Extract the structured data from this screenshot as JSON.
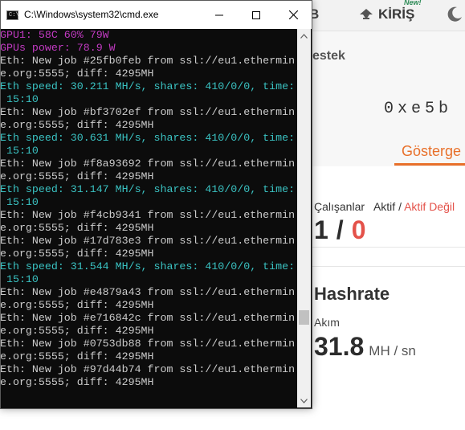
{
  "browser": {
    "nav_partial": "B",
    "login_label": "KİRİŞ",
    "new_badge": "New!",
    "request_partial": "estek",
    "wallet_partial": "0xe5b",
    "tab_dashboard_partial": "Gösterge",
    "workers": {
      "label": "Çalışanlar",
      "active_label": "Aktif",
      "separator": "/",
      "inactive_label": "Aktif Değil",
      "active_count": "1",
      "slash": "/",
      "inactive_count": "0"
    },
    "hashrate": {
      "title": "Hashrate",
      "current_label": "Akım",
      "current_value": "31.8",
      "unit": "MH / sn"
    },
    "colors": {
      "accent": "#e8702a",
      "inactive": "#e4524a"
    }
  },
  "cmd": {
    "title": "C:\\Windows\\system32\\cmd.exe",
    "icon_label": "C:\\",
    "lines": [
      {
        "text": "GPU1: 58C 60% 79W",
        "color": "magenta"
      },
      {
        "text": "GPUs power: 78.9 W",
        "color": "magenta"
      },
      {
        "text": "Eth: New job #25fb0feb from ssl://eu1.ethermin",
        "color": "gray"
      },
      {
        "text": "e.org:5555; diff: 4295MH",
        "color": "gray"
      },
      {
        "text": "Eth speed: 30.211 MH/s, shares: 410/0/0, time:",
        "color": "teal"
      },
      {
        "text": " 15:10",
        "color": "teal"
      },
      {
        "text": "Eth: New job #bf3702ef from ssl://eu1.ethermin",
        "color": "gray"
      },
      {
        "text": "e.org:5555; diff: 4295MH",
        "color": "gray"
      },
      {
        "text": "Eth speed: 30.631 MH/s, shares: 410/0/0, time:",
        "color": "teal"
      },
      {
        "text": " 15:10",
        "color": "teal"
      },
      {
        "text": "Eth: New job #f8a93692 from ssl://eu1.ethermin",
        "color": "gray"
      },
      {
        "text": "e.org:5555; diff: 4295MH",
        "color": "gray"
      },
      {
        "text": "Eth speed: 31.147 MH/s, shares: 410/0/0, time:",
        "color": "teal"
      },
      {
        "text": " 15:10",
        "color": "teal"
      },
      {
        "text": "Eth: New job #f4cb9341 from ssl://eu1.ethermin",
        "color": "gray"
      },
      {
        "text": "e.org:5555; diff: 4295MH",
        "color": "gray"
      },
      {
        "text": "Eth: New job #17d783e3 from ssl://eu1.ethermin",
        "color": "gray"
      },
      {
        "text": "e.org:5555; diff: 4295MH",
        "color": "gray"
      },
      {
        "text": "Eth speed: 31.544 MH/s, shares: 410/0/0, time:",
        "color": "teal"
      },
      {
        "text": " 15:10",
        "color": "teal"
      },
      {
        "text": "Eth: New job #e4879a43 from ssl://eu1.ethermin",
        "color": "gray"
      },
      {
        "text": "e.org:5555; diff: 4295MH",
        "color": "gray"
      },
      {
        "text": "Eth: New job #e716842c from ssl://eu1.ethermin",
        "color": "gray"
      },
      {
        "text": "e.org:5555; diff: 4295MH",
        "color": "gray"
      },
      {
        "text": "Eth: New job #0753db88 from ssl://eu1.ethermin",
        "color": "gray"
      },
      {
        "text": "e.org:5555; diff: 4295MH",
        "color": "gray"
      },
      {
        "text": "Eth: New job #97d44b74 from ssl://eu1.ethermin",
        "color": "gray"
      },
      {
        "text": "e.org:5555; diff: 4295MH",
        "color": "gray"
      }
    ],
    "colors": {
      "gray": "#cccccc",
      "teal": "#3ac2c2",
      "magenta": "#c23ac2",
      "background": "#0c0c0c"
    }
  }
}
